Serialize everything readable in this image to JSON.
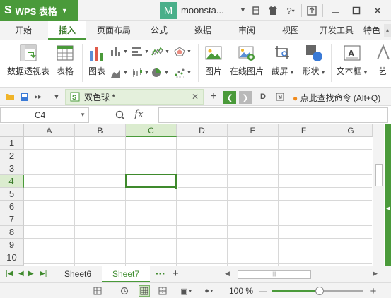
{
  "app": {
    "name": "WPS 表格",
    "logo_glyph": "S",
    "brand_color": "#4a9a3a"
  },
  "user": {
    "avatar_letter": "M",
    "name": "moonsta...",
    "avatar_color": "#4aaf8a"
  },
  "title_icons": [
    "shirt-icon",
    "tshirt-icon",
    "help-icon",
    "upload-icon",
    "minimize-icon",
    "maximize-icon",
    "close-icon"
  ],
  "tabs": [
    {
      "label": "开始"
    },
    {
      "label": "插入"
    },
    {
      "label": "页面布局"
    },
    {
      "label": "公式"
    },
    {
      "label": "数据"
    },
    {
      "label": "审阅"
    },
    {
      "label": "视图"
    },
    {
      "label": "开发工具"
    },
    {
      "label": "特色"
    }
  ],
  "active_tab": "插入",
  "ribbon": {
    "pivot_table": "数据透视表",
    "table": "表格",
    "chart": "图表",
    "picture": "图片",
    "online_picture": "在线图片",
    "screenshot": "截屏",
    "shapes": "形状",
    "textbox": "文本框"
  },
  "docbar": {
    "document_title": "双色球 *",
    "command_search": "点此查找命令 (Alt+Q)"
  },
  "formula_bar": {
    "name_box": "C4",
    "fx_label": "fx",
    "formula": ""
  },
  "grid": {
    "columns": [
      "A",
      "B",
      "C",
      "D",
      "E",
      "F",
      "G"
    ],
    "rows": [
      "1",
      "2",
      "3",
      "4",
      "5",
      "6",
      "7",
      "8",
      "9",
      "10"
    ],
    "selected_column": "C",
    "selected_row": "4"
  },
  "sheets": [
    {
      "name": "Sheet6"
    },
    {
      "name": "Sheet7"
    }
  ],
  "active_sheet": "Sheet7",
  "status": {
    "zoom": "100 %",
    "zoom_minus": "—",
    "zoom_plus": "+"
  }
}
